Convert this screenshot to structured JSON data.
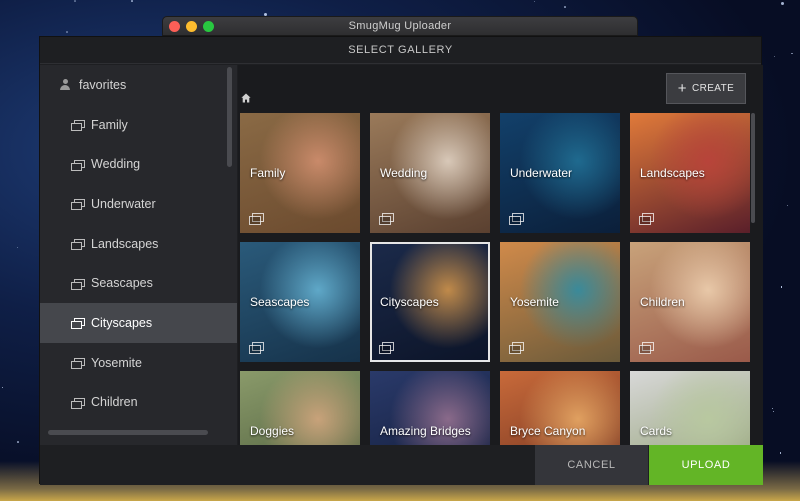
{
  "window": {
    "title": "SmugMug Uploader"
  },
  "dialog": {
    "title": "SELECT GALLERY"
  },
  "sidebar": {
    "root": {
      "label": "favorites",
      "icon": "user-icon"
    },
    "items": [
      {
        "label": "Family",
        "icon": "gallery-icon",
        "active": false
      },
      {
        "label": "Wedding",
        "icon": "gallery-icon",
        "active": false
      },
      {
        "label": "Underwater",
        "icon": "gallery-icon",
        "active": false
      },
      {
        "label": "Landscapes",
        "icon": "gallery-icon",
        "active": false
      },
      {
        "label": "Seascapes",
        "icon": "gallery-icon",
        "active": false
      },
      {
        "label": "Cityscapes",
        "icon": "gallery-icon",
        "active": true
      },
      {
        "label": "Yosemite",
        "icon": "gallery-icon",
        "active": false
      },
      {
        "label": "Children",
        "icon": "gallery-icon",
        "active": false
      }
    ]
  },
  "toolbar": {
    "home_icon": "home-icon",
    "create_label": "CREATE",
    "create_icon": "plus-icon"
  },
  "galleries": [
    {
      "label": "Family",
      "selected": false,
      "colors": [
        "#8a6a45",
        "#c98a6a",
        "#6b4a2e"
      ]
    },
    {
      "label": "Wedding",
      "selected": false,
      "colors": [
        "#9a7a5a",
        "#d8c8b8",
        "#5a4030"
      ]
    },
    {
      "label": "Underwater",
      "selected": false,
      "colors": [
        "#12406a",
        "#1f6a8f",
        "#0b1f3a"
      ]
    },
    {
      "label": "Landscapes",
      "selected": false,
      "colors": [
        "#e07a3a",
        "#b8443a",
        "#5a1f2a"
      ]
    },
    {
      "label": "Seascapes",
      "selected": false,
      "colors": [
        "#2a5a7a",
        "#5fa8c8",
        "#16324a"
      ]
    },
    {
      "label": "Cityscapes",
      "selected": true,
      "colors": [
        "#1b2a4a",
        "#c08a4a",
        "#0c1428"
      ]
    },
    {
      "label": "Yosemite",
      "selected": false,
      "colors": [
        "#d08a4a",
        "#3a8a9a",
        "#6a5a3a"
      ]
    },
    {
      "label": "Children",
      "selected": false,
      "colors": [
        "#c8a27a",
        "#e8c8a8",
        "#9a5a4a"
      ]
    },
    {
      "label": "Doggies",
      "selected": false,
      "colors": [
        "#8a9a6a",
        "#c8a27a",
        "#4a5a3a"
      ]
    },
    {
      "label": "Amazing Bridges",
      "selected": false,
      "colors": [
        "#2a3a6a",
        "#8a6a8a",
        "#101a36"
      ]
    },
    {
      "label": "Bryce Canyon",
      "selected": false,
      "colors": [
        "#c86a3a",
        "#e0a060",
        "#6a2e1e"
      ]
    },
    {
      "label": "Cards",
      "selected": false,
      "colors": [
        "#d8d8d8",
        "#b8c8a0",
        "#8a9a6a"
      ]
    }
  ],
  "footer": {
    "cancel_label": "CANCEL",
    "upload_label": "UPLOAD"
  },
  "colors": {
    "upload_accent": "#63b526",
    "active_row": "#45474c"
  }
}
